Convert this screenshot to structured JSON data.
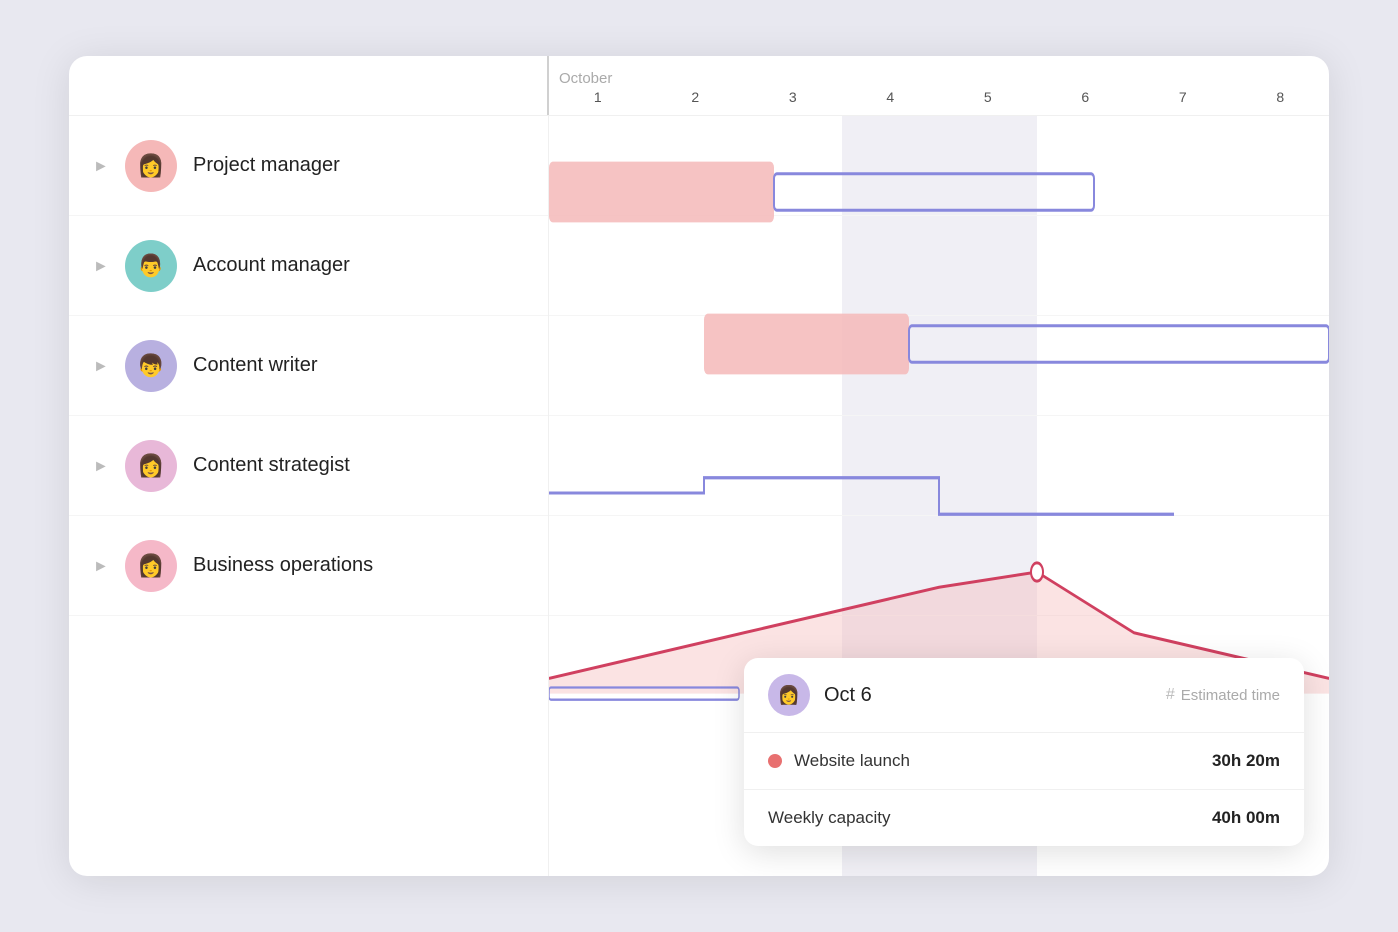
{
  "chart": {
    "month": "October",
    "days": [
      "1",
      "2",
      "3",
      "4",
      "5",
      "6",
      "7",
      "8"
    ],
    "rows": [
      {
        "id": "pm",
        "name": "Project manager",
        "avatarClass": "pm",
        "avatarEmoji": "👩"
      },
      {
        "id": "am",
        "name": "Account manager",
        "avatarClass": "am",
        "avatarEmoji": "👨"
      },
      {
        "id": "cw",
        "name": "Content writer",
        "avatarClass": "cw",
        "avatarEmoji": "👦"
      },
      {
        "id": "cs",
        "name": "Content strategist",
        "avatarClass": "cs",
        "avatarEmoji": "👩"
      },
      {
        "id": "bo",
        "name": "Business operations",
        "avatarClass": "bo",
        "avatarEmoji": "👩"
      }
    ]
  },
  "tooltip": {
    "date": "Oct 6",
    "col_label": "# Estimated time",
    "items": [
      {
        "label": "Website launch",
        "value": "30h 20m",
        "dot_color": "#e87070"
      },
      {
        "label": "Weekly capacity",
        "value": "40h 00m",
        "dot_color": null
      }
    ]
  }
}
